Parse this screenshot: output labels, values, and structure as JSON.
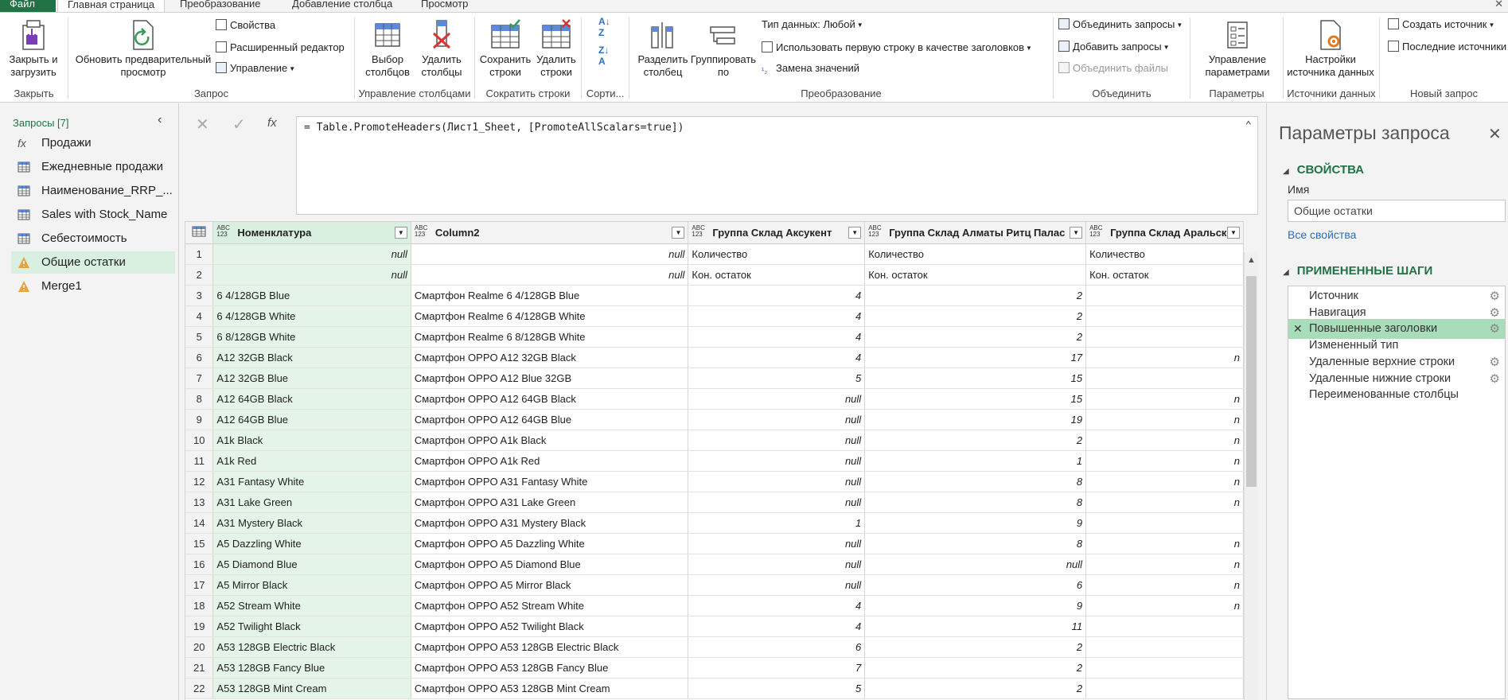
{
  "tabs": [
    "Файл",
    "Главная страница",
    "Преобразование",
    "Добавление столбца",
    "Просмотр"
  ],
  "ribbon": {
    "close_load": "Закрыть и загрузить",
    "refresh": "Обновить предварительный просмотр",
    "properties": "Свойства",
    "advanced_editor": "Расширенный редактор",
    "manage": "Управление",
    "choose_columns": "Выбор столбцов",
    "remove_columns": "Удалить столбцы",
    "keep_rows": "Сохранить строки",
    "remove_rows": "Удалить строки",
    "split_column": "Разделить столбец",
    "group_by": "Группировать по",
    "data_type": "Тип данных: Любой",
    "use_first_row": "Использовать первую строку в качестве заголовков",
    "replace_values": "Замена значений",
    "merge_queries": "Объединить запросы",
    "append_queries": "Добавить запросы",
    "combine_files": "Объединить файлы",
    "manage_params": "Управление параметрами",
    "datasource_settings": "Настройки источника данных",
    "new_source": "Создать источник",
    "recent_sources": "Последние источники",
    "groups": {
      "close": "Закрыть",
      "query": "Запрос",
      "manage_columns": "Управление столбцами",
      "reduce_rows": "Сократить строки",
      "sort": "Сорти...",
      "transform": "Преобразование",
      "combine": "Объединить",
      "parameters": "Параметры",
      "data_sources": "Источники данных",
      "new_query": "Новый запрос"
    }
  },
  "nav": {
    "title": "Запросы [7]",
    "queries": [
      {
        "name": "Продажи",
        "icon": "fx-icon"
      },
      {
        "name": "Ежедневные продажи",
        "icon": "table-icon"
      },
      {
        "name": "Наименование_RRP_...",
        "icon": "table-icon"
      },
      {
        "name": "Sales with Stock_Name",
        "icon": "table-icon"
      },
      {
        "name": "Себестоимость",
        "icon": "table-icon"
      },
      {
        "name": "Общие остатки",
        "icon": "warning-icon"
      },
      {
        "name": "Merge1",
        "icon": "warning-icon"
      }
    ]
  },
  "formula": "= Table.PromoteHeaders(Лист1_Sheet, [PromoteAllScalars=true])",
  "grid": {
    "type_badge": [
      "ABC",
      "123"
    ],
    "columns": [
      "Номенклатура",
      "Column2",
      "Группа Склад Аксукент",
      "Группа Склад Алматы Ритц Палас",
      "Группа Склад Аральск"
    ],
    "rows": [
      [
        "1",
        "null",
        "null",
        "Количество",
        "Количество",
        "Количество"
      ],
      [
        "2",
        "null",
        "null",
        "Кон. остаток",
        "Кон. остаток",
        "Кон. остаток"
      ],
      [
        "3",
        "6 4/128GB Blue",
        "Смартфон Realme 6 4/128GB Blue",
        "4",
        "2",
        ""
      ],
      [
        "4",
        "6 4/128GB White",
        "Смартфон Realme 6 4/128GB White",
        "4",
        "2",
        ""
      ],
      [
        "5",
        "6 8/128GB White",
        "Смартфон Realme 6 8/128GB White",
        "4",
        "2",
        ""
      ],
      [
        "6",
        "A12 32GB Black",
        "Смартфон OPPO A12 32GB Black",
        "4",
        "17",
        "n"
      ],
      [
        "7",
        "A12 32GB Blue",
        "Смартфон OPPO A12 Blue 32GB",
        "5",
        "15",
        ""
      ],
      [
        "8",
        "A12 64GB Black",
        "Смартфон OPPO A12 64GB Black",
        "null",
        "15",
        "n"
      ],
      [
        "9",
        "A12 64GB Blue",
        "Смартфон OPPO A12 64GB Blue",
        "null",
        "19",
        "n"
      ],
      [
        "10",
        "A1k Black",
        "Смартфон OPPO A1k Black",
        "null",
        "2",
        "n"
      ],
      [
        "11",
        "A1k Red",
        "Смартфон OPPO A1k Red",
        "null",
        "1",
        "n"
      ],
      [
        "12",
        "A31 Fantasy White",
        "Смартфон OPPO A31 Fantasy White",
        "null",
        "8",
        "n"
      ],
      [
        "13",
        "A31 Lake Green",
        "Смартфон OPPO A31 Lake Green",
        "null",
        "8",
        "n"
      ],
      [
        "14",
        "A31 Mystery Black",
        "Смартфон OPPO A31 Mystery Black",
        "1",
        "9",
        ""
      ],
      [
        "15",
        "A5 Dazzling White",
        "Смартфон OPPO A5 Dazzling White",
        "null",
        "8",
        "n"
      ],
      [
        "16",
        "A5 Diamond Blue",
        "Смартфон OPPO A5 Diamond Blue",
        "null",
        "null",
        "n"
      ],
      [
        "17",
        "A5 Mirror Black",
        "Смартфон OPPO A5 Mirror Black",
        "null",
        "6",
        "n"
      ],
      [
        "18",
        "A52 Stream White",
        "Смартфон OPPO A52 Stream White",
        "4",
        "9",
        "n"
      ],
      [
        "19",
        "A52 Twilight Black",
        "Смартфон OPPO A52 Twilight Black",
        "4",
        "11",
        ""
      ],
      [
        "20",
        "A53 128GB Electric Black",
        "Смартфон OPPO A53 128GB Electric Black",
        "6",
        "2",
        ""
      ],
      [
        "21",
        "A53 128GB Fancy Blue",
        "Смартфон OPPO A53 128GB Fancy Blue",
        "7",
        "2",
        ""
      ],
      [
        "22",
        "A53 128GB Mint Cream",
        "Смартфон OPPO A53 128GB Mint Cream",
        "5",
        "2",
        ""
      ]
    ]
  },
  "settings": {
    "title": "Параметры запроса",
    "properties_header": "СВОЙСТВА",
    "name_label": "Имя",
    "name_value": "Общие остатки",
    "all_properties": "Все свойства",
    "steps_header": "ПРИМЕНЕННЫЕ ШАГИ",
    "steps": [
      {
        "name": "Источник",
        "gear": true,
        "selected": false
      },
      {
        "name": "Навигация",
        "gear": true,
        "selected": false
      },
      {
        "name": "Повышенные заголовки",
        "gear": true,
        "selected": true
      },
      {
        "name": "Измененный тип",
        "gear": false,
        "selected": false
      },
      {
        "name": "Удаленные верхние строки",
        "gear": true,
        "selected": false
      },
      {
        "name": "Удаленные нижние строки",
        "gear": true,
        "selected": false
      },
      {
        "name": "Переименованные столбцы",
        "gear": false,
        "selected": false
      }
    ]
  },
  "colors": {
    "accent": "#217346",
    "selection": "#d9f0e0",
    "step_selected": "#a9dcb9",
    "link": "#2e6dbf"
  }
}
